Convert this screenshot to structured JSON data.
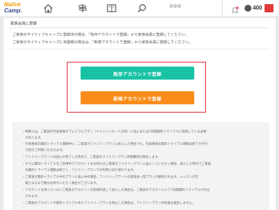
{
  "header": {
    "logo_line1": "Native",
    "logo_line2": "Camp.",
    "more_label": "ooo",
    "coin_count": "400",
    "icons": [
      "home-icon",
      "signpost-icon",
      "book-icon",
      "search-icon",
      "bell-icon",
      "coin-icon",
      "flag-icon"
    ],
    "colors": {
      "logo_orange": "#f39800",
      "logo_navy": "#2d3f8a"
    }
  },
  "section": {
    "title": "家族会員に登録",
    "desc_line1": "ご家族がネイティブキャンプに登録済の場合、「既存アカウントで登録」から家族会員に登録してください。",
    "desc_line2": "ご家族がネイティブキャンプに未登録の場合は、「新規アカウントで登録」から家族会員に登録してください。"
  },
  "buttons": {
    "existing_label": "既存アカウントで登録",
    "new_label": "新規アカウントで登録",
    "colors": {
      "existing": "#19c2a5",
      "new": "#f98d1c",
      "highlight_border": "#e2242c"
    }
  },
  "notes": [
    "・特典には、ご家族の代表者様がプレミアムプラン（クレジットカード決済）に加入または7日間無料トライアルに登録している必要",
    "　があります。",
    "・代表者様の無料トライアル期間中に、ご家族がファミリープランに加入した場合でも、代表者様の無料トライアル期間は終了せず引",
    "　き続きご利用いただけます。",
    "・ファミリープランへの加入が完了した時点で、ご家族のファミリープラン月額費用が発生します。",
    "・すでに無料トライアルをご利用中でアカウントをお持ちのご家族をファミリープランに加入していただく場合、加入した時点でご家族",
    "　の無料トライアル期間は終了し、ファミリープランでの利用に切り替わります。",
    "・ご家族が無料トライアル中のプランに加入中の場合、ファミリープランへの家族会一度プランが解除されます。レッスンが可",
    "　能となるまで数分お待ちいただく場合がございます。",
    "・アカウントを持っていないご家族のアカウントを新規作成して加入した場合は、ご家族のアカウントにて7日間無料トライアルが付与",
    "　されます。",
    "・ご家族のアカウントが無料トライアル中にファミリープランを停止した場合は、ファミリープランの料金は発生しません。"
  ]
}
